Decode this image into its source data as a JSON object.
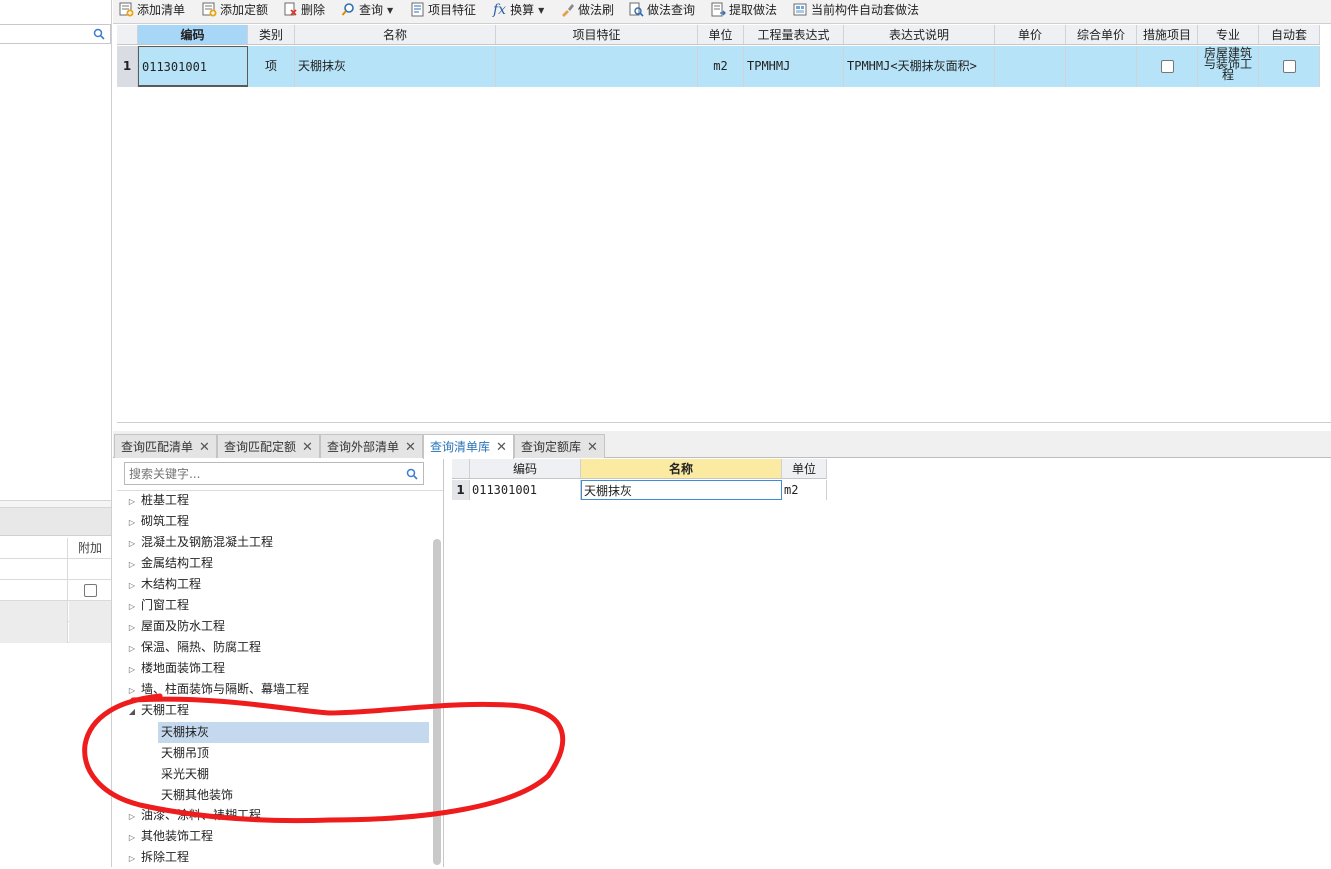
{
  "toolbar": {
    "buttons": [
      {
        "label": "添加清单",
        "icon": "add-list-icon"
      },
      {
        "label": "添加定额",
        "icon": "add-quota-icon"
      },
      {
        "label": "删除",
        "icon": "delete-icon"
      },
      {
        "label": "查询",
        "icon": "query-icon"
      },
      {
        "label": "项目特征",
        "icon": "feature-icon"
      },
      {
        "label": "换算",
        "icon": "fx-icon",
        "glyph": "fx"
      },
      {
        "label": "做法刷",
        "icon": "brush-icon"
      },
      {
        "label": "做法查询",
        "icon": "method-query-icon"
      },
      {
        "label": "提取做法",
        "icon": "extract-icon"
      },
      {
        "label": "当前构件自动套做法",
        "icon": "auto-apply-icon"
      }
    ]
  },
  "main_grid": {
    "columns": [
      "编码",
      "类别",
      "名称",
      "项目特征",
      "单位",
      "工程量表达式",
      "表达式说明",
      "单价",
      "综合单价",
      "措施项目",
      "专业",
      "自动套"
    ],
    "rows": [
      {
        "index": "1",
        "code": "011301001",
        "category": "项",
        "name": "天棚抹灰",
        "feature": "",
        "unit": "m2",
        "expression": "TPMHMJ",
        "expression_desc": "TPMHMJ<天棚抹灰面积>",
        "price": "",
        "composite_price": "",
        "measure_item_checked": false,
        "profession": "房屋建筑与装饰工程",
        "auto_apply_checked": false
      }
    ]
  },
  "left_panel": {
    "column_header": "附加",
    "row_checked": false
  },
  "tabs": [
    {
      "label": "查询匹配清单",
      "active": false
    },
    {
      "label": "查询匹配定额",
      "active": false
    },
    {
      "label": "查询外部清单",
      "active": false
    },
    {
      "label": "查询清单库",
      "active": true
    },
    {
      "label": "查询定额库",
      "active": false
    }
  ],
  "tree": {
    "search_placeholder": "搜索关键字...",
    "items": [
      {
        "label": "桩基工程",
        "expanded": false
      },
      {
        "label": "砌筑工程",
        "expanded": false
      },
      {
        "label": "混凝土及钢筋混凝土工程",
        "expanded": false
      },
      {
        "label": "金属结构工程",
        "expanded": false
      },
      {
        "label": "木结构工程",
        "expanded": false
      },
      {
        "label": "门窗工程",
        "expanded": false
      },
      {
        "label": "屋面及防水工程",
        "expanded": false
      },
      {
        "label": "保温、隔热、防腐工程",
        "expanded": false
      },
      {
        "label": "楼地面装饰工程",
        "expanded": false
      },
      {
        "label": "墙、柱面装饰与隔断、幕墙工程",
        "expanded": false
      },
      {
        "label": "天棚工程",
        "expanded": true
      },
      {
        "label": "油漆、涂料、裱糊工程",
        "expanded": false
      },
      {
        "label": "其他装饰工程",
        "expanded": false
      },
      {
        "label": "拆除工程",
        "expanded": false
      }
    ],
    "children": [
      {
        "label": "天棚抹灰",
        "selected": true
      },
      {
        "label": "天棚吊顶",
        "selected": false
      },
      {
        "label": "采光天棚",
        "selected": false
      },
      {
        "label": "天棚其他装饰",
        "selected": false
      }
    ]
  },
  "result_grid": {
    "columns": [
      "编码",
      "名称",
      "单位"
    ],
    "rows": [
      {
        "index": "1",
        "code": "011301001",
        "name": "天棚抹灰",
        "unit": "m2"
      }
    ]
  },
  "colors": {
    "row_highlight": "#b6e3f7",
    "header_selected": "#a7d6f6",
    "result_header_selected": "#fbeaa2",
    "tab_active_text": "#2874b8",
    "annotation_red": "#ee1c1c",
    "tree_selected": "#c4d8ee"
  }
}
